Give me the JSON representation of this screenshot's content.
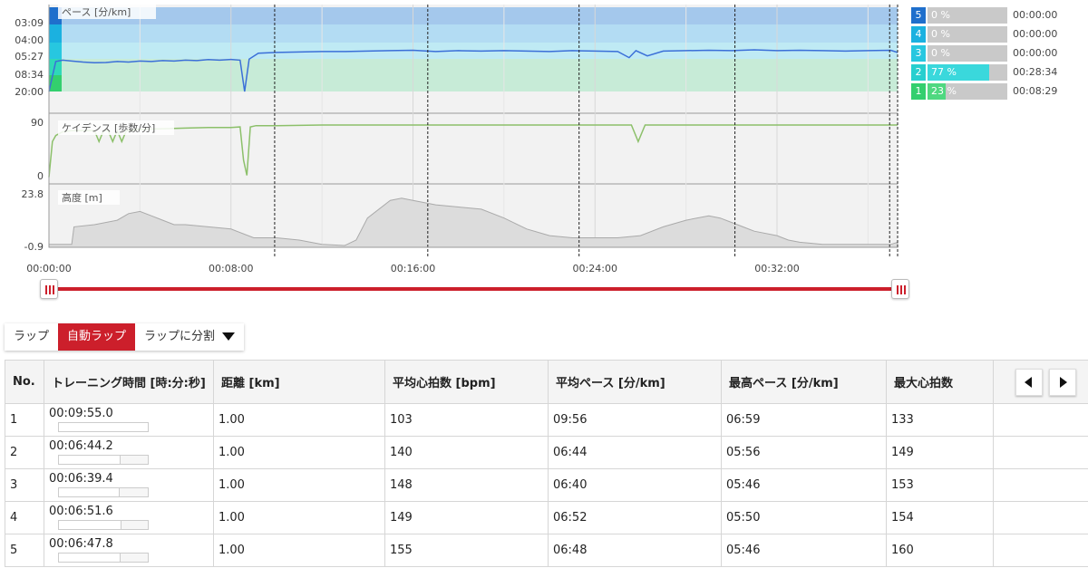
{
  "chart_data": [
    {
      "type": "line",
      "title": "ペース [分/km]",
      "y_tick_labels": [
        "03:09",
        "04:00",
        "05:27",
        "08:34",
        "20:00"
      ],
      "zones": [
        {
          "zone": "5",
          "from": "03:09",
          "to": "04:00",
          "color": "#a4c8ec"
        },
        {
          "zone": "4",
          "from": "04:00",
          "to": "05:27",
          "color": "#b3dcf3"
        },
        {
          "zone": "3",
          "from": "05:27",
          "to": "08:34",
          "color": "#bfeaf4"
        },
        {
          "zone": "1-2",
          "from": "08:34",
          "to": "20:00",
          "color": "#c7ebd7"
        }
      ],
      "series": [
        {
          "color": "#3b6fd8",
          "x_minutes": [
            0,
            0.3,
            0.6,
            1,
            1.5,
            2,
            2.5,
            3,
            3.5,
            4,
            4.5,
            5,
            5.5,
            6,
            6.5,
            7,
            7.5,
            8,
            8.4,
            8.6,
            8.8,
            9.2,
            10,
            11,
            12,
            13,
            14,
            15,
            16,
            17,
            18,
            19,
            20,
            21,
            22,
            23,
            24,
            25,
            25.5,
            25.8,
            26.3,
            27,
            28,
            29,
            30,
            31,
            32,
            33,
            34,
            35,
            36,
            37,
            37.3
          ],
          "y_pace": [
            "20:00",
            "09:30",
            "09:00",
            "09:20",
            "09:40",
            "09:55",
            "09:50",
            "09:30",
            "09:40",
            "09:20",
            "09:30",
            "09:10",
            "09:20",
            "09:00",
            "09:10",
            "08:50",
            "09:00",
            "08:45",
            "09:00",
            "20:00",
            "08:40",
            "07:30",
            "07:20",
            "07:15",
            "07:10",
            "07:10",
            "07:05",
            "07:00",
            "06:55",
            "07:10",
            "07:00",
            "07:05",
            "07:00",
            "07:05",
            "07:10",
            "07:00",
            "07:05",
            "07:10",
            "08:20",
            "07:00",
            "08:00",
            "07:05",
            "07:00",
            "06:55",
            "07:00",
            "06:50",
            "07:00",
            "06:55",
            "07:00",
            "07:05",
            "07:00",
            "06:55",
            "07:20"
          ]
        }
      ]
    },
    {
      "type": "line",
      "title": "ケイデンス [歩数/分]",
      "ylim": [
        0,
        90
      ],
      "y_tick_labels": [
        "90",
        "0"
      ],
      "series": [
        {
          "color": "#8cc06a",
          "x_minutes": [
            0,
            0.15,
            0.3,
            0.6,
            1,
            2,
            2.2,
            2.4,
            2.6,
            2.8,
            3,
            3.2,
            3.4,
            3.6,
            3.8,
            4,
            5,
            6,
            7,
            8,
            8.4,
            8.55,
            8.7,
            8.85,
            9.1,
            10,
            12,
            14,
            16,
            18,
            20,
            22,
            24,
            25.6,
            25.9,
            26.2,
            28,
            30,
            32,
            34,
            36,
            37.3
          ],
          "y": [
            2,
            60,
            70,
            76,
            78,
            78,
            60,
            78,
            78,
            60,
            78,
            60,
            78,
            78,
            80,
            80,
            81,
            82,
            83,
            83,
            84,
            30,
            5,
            84,
            86,
            86,
            87,
            87,
            87,
            87,
            87,
            87,
            87,
            87,
            60,
            87,
            87,
            87,
            87,
            87,
            87,
            87
          ]
        }
      ]
    },
    {
      "type": "area",
      "title": "高度 [m]",
      "ylim": [
        -0.9,
        23.8
      ],
      "y_tick_labels": [
        "23.8",
        "-0.9"
      ],
      "series": [
        {
          "color": "#aaaaaa",
          "fill": "#dcdcdc",
          "x_minutes": [
            0,
            1,
            1.1,
            2,
            3,
            3.5,
            4,
            4.5,
            5,
            5.5,
            6,
            7,
            8,
            9,
            10,
            11,
            12,
            13,
            13.5,
            14,
            15,
            15.5,
            16,
            17,
            18,
            19,
            20,
            21,
            22,
            23,
            24,
            25,
            26,
            27,
            28,
            29,
            29.5,
            30,
            30.5,
            31,
            32,
            32.5,
            33,
            34,
            35,
            36,
            37,
            37.3
          ],
          "y": [
            0,
            0,
            8,
            9,
            11,
            14,
            15,
            13,
            11,
            9,
            9,
            8,
            7,
            3,
            3,
            2,
            0,
            -0.5,
            2,
            12,
            20,
            21,
            20,
            18,
            17,
            16,
            12,
            7,
            4,
            3,
            3,
            3,
            4,
            8,
            11,
            13,
            12,
            10,
            8,
            6,
            4,
            2,
            1,
            0,
            0,
            0,
            0,
            1,
            4,
            10,
            11,
            10,
            8,
            10,
            13,
            11,
            9,
            6,
            3,
            3,
            3,
            3
          ]
        }
      ]
    }
  ],
  "x_axis": {
    "tick_labels": [
      "00:00:00",
      "00:08:00",
      "00:16:00",
      "00:24:00",
      "00:32:00"
    ],
    "tick_minutes": [
      0,
      8,
      16,
      24,
      32
    ],
    "range_minutes": [
      0,
      37.3
    ],
    "lap_markers_minutes": [
      9.92,
      16.65,
      23.3,
      30.15,
      36.95,
      37.3
    ],
    "grid_minutes": [
      8,
      16,
      24,
      32
    ]
  },
  "pace_panel": {
    "label": "ペース [分/km]"
  },
  "cadence_panel": {
    "label": "ケイデンス [歩数/分]"
  },
  "altitude_panel": {
    "label": "高度 [m]"
  },
  "zone_legend": [
    {
      "zone": "5",
      "percent_label": "0 %",
      "fraction": 0,
      "time": "00:00:00",
      "color": "#1f6fcc",
      "fill_color": "#58a8e6"
    },
    {
      "zone": "4",
      "percent_label": "0 %",
      "fraction": 0,
      "time": "00:00:00",
      "color": "#1bb1e0",
      "fill_color": "#4cc6ea"
    },
    {
      "zone": "3",
      "percent_label": "0 %",
      "fraction": 0,
      "time": "00:00:00",
      "color": "#27c7e0",
      "fill_color": "#43d3e8"
    },
    {
      "zone": "2",
      "percent_label": "77 %",
      "fraction": 0.77,
      "time": "00:28:34",
      "color": "#27cfcf",
      "fill_color": "#3ad8dc"
    },
    {
      "zone": "1",
      "percent_label": "23 %",
      "fraction": 0.23,
      "time": "00:08:29",
      "color": "#33cf6e",
      "fill_color": "#4fd880"
    }
  ],
  "lap_controls": {
    "lap": "ラップ",
    "auto_lap": "自動ラップ",
    "split": "ラップに分割"
  },
  "table": {
    "headers": {
      "no": "No.",
      "time": "トレーニング時間 [時:分:秒]",
      "distance": "距離 [km]",
      "avg_hr": "平均心拍数 [bpm]",
      "avg_pace": "平均ペース [分/km]",
      "max_pace": "最高ペース [分/km]",
      "max_hr": "最大心拍数"
    },
    "rows": [
      {
        "no": "1",
        "time": "00:09:55.0",
        "time_fraction": 1.0,
        "distance": "1.00",
        "avg_hr": "103",
        "avg_pace": "09:56",
        "max_pace": "06:59",
        "max_hr": "133"
      },
      {
        "no": "2",
        "time": "00:06:44.2",
        "time_fraction": 0.68,
        "distance": "1.00",
        "avg_hr": "140",
        "avg_pace": "06:44",
        "max_pace": "05:56",
        "max_hr": "149"
      },
      {
        "no": "3",
        "time": "00:06:39.4",
        "time_fraction": 0.67,
        "distance": "1.00",
        "avg_hr": "148",
        "avg_pace": "06:40",
        "max_pace": "05:46",
        "max_hr": "153"
      },
      {
        "no": "4",
        "time": "00:06:51.6",
        "time_fraction": 0.69,
        "distance": "1.00",
        "avg_hr": "149",
        "avg_pace": "06:52",
        "max_pace": "05:50",
        "max_hr": "154"
      },
      {
        "no": "5",
        "time": "00:06:47.8",
        "time_fraction": 0.68,
        "distance": "1.00",
        "avg_hr": "155",
        "avg_pace": "06:48",
        "max_pace": "05:46",
        "max_hr": "160"
      }
    ]
  }
}
